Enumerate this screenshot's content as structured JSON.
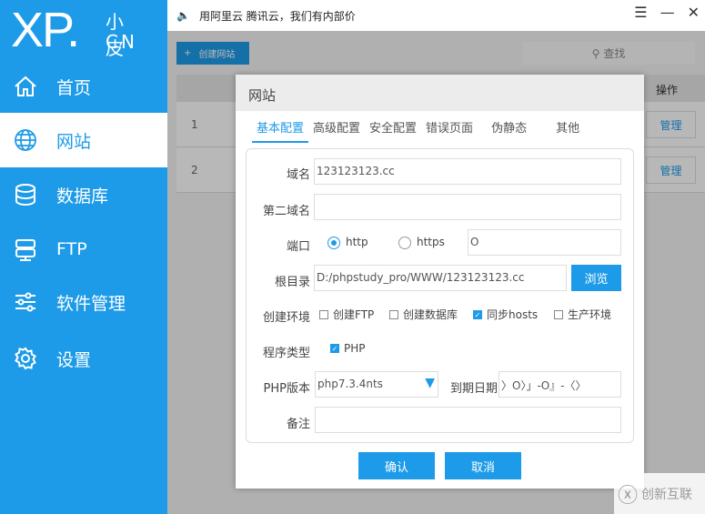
{
  "logo": {
    "xp": "XP.",
    "xiao": "小皮",
    "cn": "CN"
  },
  "sidebar": {
    "items": [
      {
        "label": "首页",
        "icon": "home-icon"
      },
      {
        "label": "网站",
        "icon": "globe-icon"
      },
      {
        "label": "数据库",
        "icon": "database-icon"
      },
      {
        "label": "FTP",
        "icon": "server-icon"
      },
      {
        "label": "软件管理",
        "icon": "sliders-icon"
      },
      {
        "label": "设置",
        "icon": "gear-icon"
      }
    ]
  },
  "topbar": {
    "notice": "用阿里云 腾讯云，我们有内部价"
  },
  "toolbar": {
    "create": "创建网站",
    "search": "查找"
  },
  "table": {
    "op_header": "操作",
    "rows": [
      {
        "n": "1",
        "action": "管理"
      },
      {
        "n": "2",
        "action": "管理"
      }
    ]
  },
  "modal": {
    "title": "网站",
    "tabs": [
      "基本配置",
      "高级配置",
      "安全配置",
      "错误页面",
      "伪静态",
      "其他"
    ],
    "domain_label": "域名",
    "domain": "123123123.cc",
    "domain2_label": "第二域名",
    "domain2": "",
    "port_label": "端口",
    "http": "http",
    "https": "https",
    "port": "O",
    "root_label": "根目录",
    "root": "D:/phpstudy_pro/WWW/123123123.cc",
    "browse": "浏览",
    "env_label": "创建环境",
    "env": [
      {
        "label": "创建FTP",
        "checked": false
      },
      {
        "label": "创建数据库",
        "checked": false
      },
      {
        "label": "同步hosts",
        "checked": true
      },
      {
        "label": "生产环境",
        "checked": false
      }
    ],
    "type_label": "程序类型",
    "type": "PHP",
    "php_label": "PHP版本",
    "php": "php7.3.4nts",
    "expire_label": "到期日期",
    "expire": "〉O〉」-O』-〈〉",
    "note_label": "备注",
    "note": "",
    "ok": "确认",
    "cancel": "取消"
  },
  "watermark": "创新互联"
}
